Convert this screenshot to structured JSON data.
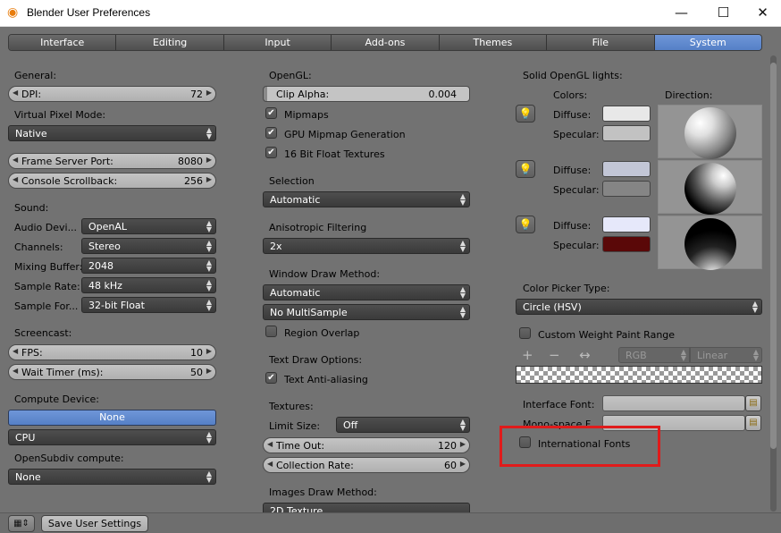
{
  "window": {
    "title": "Blender User Preferences",
    "minimize": "—",
    "maximize": "☐",
    "close": "✕"
  },
  "tabs": [
    "Interface",
    "Editing",
    "Input",
    "Add-ons",
    "Themes",
    "File",
    "System"
  ],
  "active_tab": "System",
  "col1": {
    "general": "General:",
    "dpi": {
      "label": "DPI:",
      "value": "72"
    },
    "virtual_pixel_mode": "Virtual Pixel Mode:",
    "virtual_pixel_value": "Native",
    "frame_server_port": {
      "label": "Frame Server Port:",
      "value": "8080"
    },
    "console_scrollback": {
      "label": "Console Scrollback:",
      "value": "256"
    },
    "sound": "Sound:",
    "audio_device": {
      "label": "Audio Devi...",
      "value": "OpenAL"
    },
    "channels": {
      "label": "Channels:",
      "value": "Stereo"
    },
    "mixing_buffer": {
      "label": "Mixing Buffer:",
      "value": "2048"
    },
    "sample_rate": {
      "label": "Sample Rate:",
      "value": "48 kHz"
    },
    "sample_format": {
      "label": "Sample For...",
      "value": "32-bit Float"
    },
    "screencast": "Screencast:",
    "fps": {
      "label": "FPS:",
      "value": "10"
    },
    "wait_timer": {
      "label": "Wait Timer (ms):",
      "value": "50"
    },
    "compute_device": "Compute Device:",
    "compute_none": "None",
    "cpu": "CPU",
    "opensubdiv": "OpenSubdiv compute:",
    "opensubdiv_value": "None"
  },
  "col2": {
    "opengl": "OpenGL:",
    "clip_alpha": {
      "label": "Clip Alpha:",
      "value": "0.004"
    },
    "mipmaps": "Mipmaps",
    "gpu_mipmap": "GPU Mipmap Generation",
    "float_textures": "16 Bit Float Textures",
    "selection": "Selection",
    "selection_value": "Automatic",
    "aniso": "Anisotropic Filtering",
    "aniso_value": "2x",
    "window_draw": "Window Draw Method:",
    "window_draw_value": "Automatic",
    "multisample_value": "No MultiSample",
    "region_overlap": "Region Overlap",
    "text_draw": "Text Draw Options:",
    "text_aa": "Text Anti-aliasing",
    "textures": "Textures:",
    "limit_size": "Limit Size:",
    "limit_size_value": "Off",
    "time_out": {
      "label": "Time Out:",
      "value": "120"
    },
    "collection_rate": {
      "label": "Collection Rate:",
      "value": "60"
    },
    "images_draw": "Images Draw Method:",
    "images_draw_value": "2D Texture"
  },
  "col3": {
    "solid_lights": "Solid OpenGL lights:",
    "colors": "Colors:",
    "direction": "Direction:",
    "diffuse": "Diffuse:",
    "specular": "Specular:",
    "light_colors": [
      {
        "diffuse": "#e8e8e8",
        "specular": "#c2c2c2"
      },
      {
        "diffuse": "#c2c6d6",
        "specular": "#858585"
      },
      {
        "diffuse": "#e6e8fa",
        "specular": "#5a0808"
      }
    ],
    "color_picker_type": "Color Picker Type:",
    "color_picker_value": "Circle (HSV)",
    "custom_weight": "Custom Weight Paint Range",
    "plus": "+",
    "minus": "−",
    "arrows": "↔",
    "rgb": "RGB",
    "linear": "Linear",
    "interface_font": "Interface Font:",
    "monospace_font": "Mono-space F...",
    "international_fonts": "International Fonts"
  },
  "bottom": {
    "save_label": "Save User Settings"
  }
}
